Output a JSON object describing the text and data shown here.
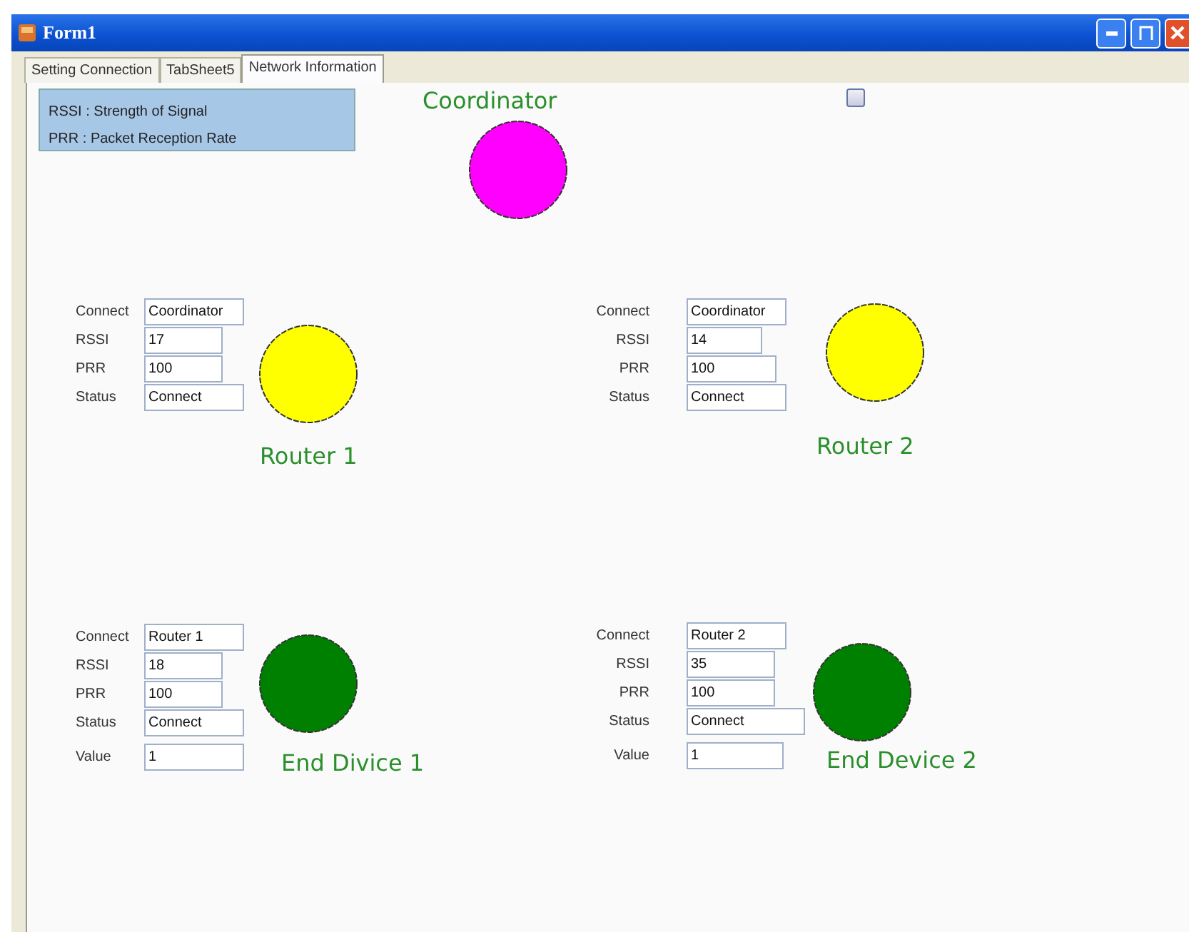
{
  "window": {
    "title": "Form1"
  },
  "tabs": [
    {
      "label": "Setting Connection",
      "selected": false
    },
    {
      "label": "TabSheet5",
      "selected": false
    },
    {
      "label": "Network Information",
      "selected": true
    }
  ],
  "legend": [
    "RSSI : Strength of Signal",
    "PRR : Packet Reception Rate"
  ],
  "checkbox": {
    "checked": false
  },
  "coordinator": {
    "label": "Coordinator",
    "color": "#ff00ff"
  },
  "nodes": [
    {
      "label": "Router 1",
      "color": "#ffff00",
      "fields": [
        {
          "label": "Connect",
          "value": "Coordinator"
        },
        {
          "label": "RSSI",
          "value": "17"
        },
        {
          "label": "PRR",
          "value": "100"
        },
        {
          "label": "Status",
          "value": "Connect"
        }
      ]
    },
    {
      "label": "Router 2",
      "color": "#ffff00",
      "fields": [
        {
          "label": "Connect",
          "value": "Coordinator"
        },
        {
          "label": "RSSI",
          "value": "14"
        },
        {
          "label": "PRR",
          "value": "100"
        },
        {
          "label": "Status",
          "value": "Connect"
        }
      ]
    },
    {
      "label": "End Divice 1",
      "color": "#008000",
      "fields": [
        {
          "label": "Connect",
          "value": "Router 1"
        },
        {
          "label": "RSSI",
          "value": "18"
        },
        {
          "label": "PRR",
          "value": "100"
        },
        {
          "label": "Status",
          "value": "Connect"
        },
        {
          "label": "Value",
          "value": "1"
        }
      ]
    },
    {
      "label": "End Device 2",
      "color": "#008000",
      "fields": [
        {
          "label": "Connect",
          "value": "Router 2"
        },
        {
          "label": "RSSI",
          "value": "35"
        },
        {
          "label": "PRR",
          "value": "100"
        },
        {
          "label": "Status",
          "value": "Connect"
        },
        {
          "label": "Value",
          "value": "1"
        }
      ]
    }
  ]
}
